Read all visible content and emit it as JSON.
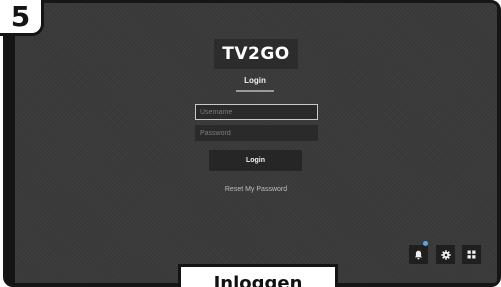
{
  "step": {
    "number": "5"
  },
  "app": {
    "logo": "TV2GO"
  },
  "login_form": {
    "tab_label": "Login",
    "username_placeholder": "Username",
    "password_placeholder": "Password",
    "submit_label": "Login",
    "reset_link": "Reset My Password"
  },
  "tray": {
    "icons": [
      "bell-icon",
      "gear-icon",
      "grid-icon"
    ],
    "notification_dot_color": "#57a8e8"
  },
  "caption": {
    "text": "Inloggen"
  }
}
